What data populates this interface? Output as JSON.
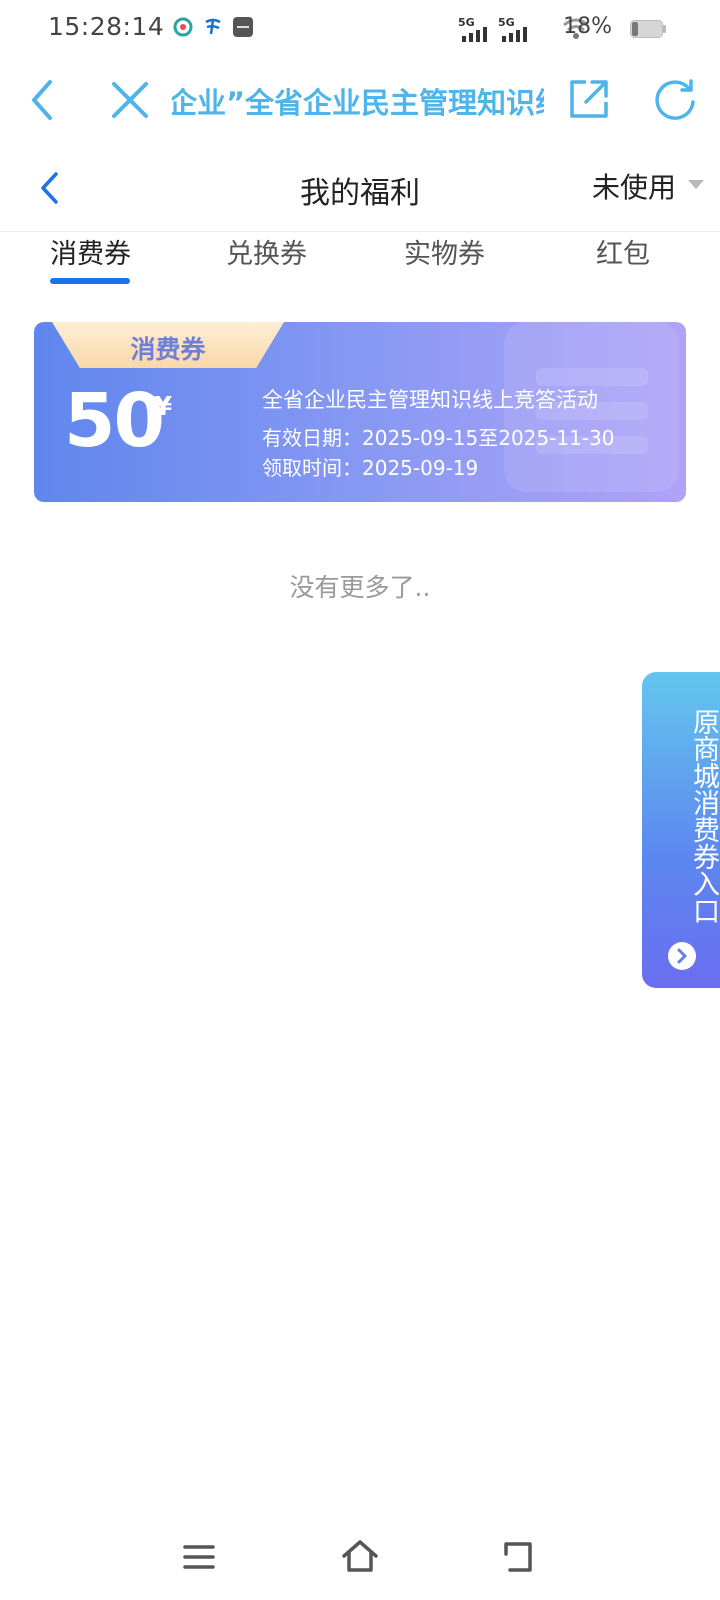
{
  "status_bar": {
    "time": "15:28:14",
    "network": "5G",
    "battery": "18%",
    "icons": [
      "mobile-carrier-icon",
      "telecom-carrier-icon",
      "vivo-app-icon",
      "signal-icon",
      "wifi-icon",
      "battery-icon"
    ]
  },
  "browser": {
    "title": "企业”全省企业民主管理知识线上竞答活动",
    "icons": [
      "back-arrow-icon",
      "close-icon",
      "external-link-icon",
      "refresh-icon"
    ]
  },
  "header": {
    "title": "我的福利",
    "filter_label": "未使用",
    "back_icon": "back-arrow-icon"
  },
  "tabs": [
    {
      "label": "消费券",
      "active": true
    },
    {
      "label": "兑换券",
      "active": false
    },
    {
      "label": "实物券",
      "active": false
    },
    {
      "label": "红包",
      "active": false
    }
  ],
  "coupon": {
    "tag": "消费券",
    "amount": "50",
    "currency": "¥",
    "name": "全省企业民主管理知识线上竞答活动",
    "valid_label": "有效日期：",
    "valid_range": "2025-09-15至2025-11-30",
    "received_label": "领取时间：",
    "received_date": "2025-09-19",
    "colors": {
      "start": "#5f86ee",
      "end": "#b0a2f8",
      "tag": "#f8d8a8"
    }
  },
  "list_end_text": "没有更多了..",
  "side_entry": {
    "label": "原商城消费券入口",
    "icon": "chevron-right-icon"
  },
  "nav": {
    "icons": [
      "menu-icon",
      "home-icon",
      "back-icon"
    ]
  },
  "colors": {
    "accent": "#1a73e8",
    "browser_blue": "#4fb4ea"
  }
}
